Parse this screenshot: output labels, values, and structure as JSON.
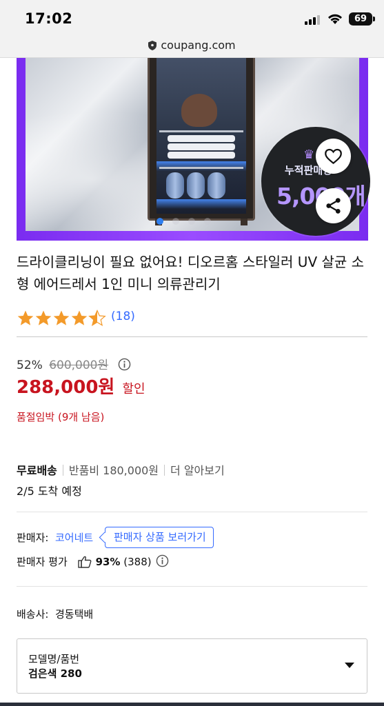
{
  "status_bar": {
    "time": "17:02",
    "battery": "69",
    "icons": [
      "signal-icon",
      "wifi-icon",
      "battery-icon"
    ]
  },
  "browser": {
    "url": "coupang.com",
    "icon": "shield-icon"
  },
  "hero": {
    "badge_line1": "누적판매량",
    "badge_line2": "5,000개",
    "carousel_index": 0,
    "carousel_count": 4,
    "icons": [
      "heart-icon",
      "share-icon"
    ]
  },
  "product": {
    "title": "드라이클리닝이 필요 없어요! 디오르홈 스타일러 UV 살균 소형 에어드레서 1인 미니 의류관리기",
    "rating_stars": 4.5,
    "rating_count": "(18)",
    "discount_rate": "52%",
    "original_price": "600,000원",
    "sale_price": "288,000원",
    "sale_tag": "할인",
    "stock_notice": "품절임박 (9개 남음)"
  },
  "shipping": {
    "free_label": "무료배송",
    "return_fee": "반품비 180,000원",
    "more_link": "더 알아보기",
    "arrival": "2/5 도착 예정"
  },
  "seller": {
    "label": "판매자:",
    "name": "코어네트",
    "products_link": "판매자 상품 보러가기",
    "rating_label": "판매자 평가",
    "rating_pct": "93%",
    "rating_count": "(388)"
  },
  "courier": {
    "text": "배송사:  경동택배"
  },
  "option": {
    "label": "모델명/품번",
    "value": "검은색 280"
  },
  "colors": {
    "accent_blue": "#346aff",
    "price_red": "#c8141f",
    "star_orange": "#f39a2a",
    "banner_purple": "#8a3cff"
  }
}
